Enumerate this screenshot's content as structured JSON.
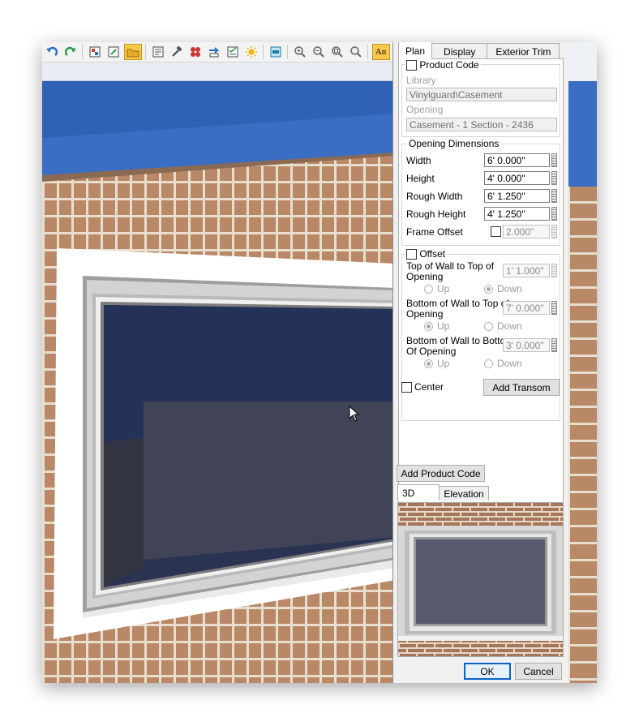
{
  "toolbar": {
    "icons": [
      "undo-icon",
      "redo-icon",
      "select-objects-icon",
      "edit-area-icon",
      "open-folder-icon",
      "plan-view-icon",
      "hammer-icon",
      "materials-icon",
      "transfer-icon",
      "checklist-icon",
      "sun-icon",
      "layer-icon",
      "zoom-in-icon",
      "zoom-out-icon",
      "zoom-fit-icon",
      "zoom-window-icon",
      "annotation-icon"
    ],
    "annotation_label": "An"
  },
  "dialog": {
    "tabs": [
      "Plan",
      "Display",
      "Exterior Trim"
    ],
    "active_tab": "Plan",
    "product_code": {
      "label": "Product Code",
      "checked": false
    },
    "library": {
      "label": "Library",
      "value": "Vinylguard\\Casement"
    },
    "opening": {
      "label": "Opening",
      "value": "Casement - 1 Section - 2436"
    },
    "opening_dimensions": {
      "title": "Opening Dimensions",
      "width": {
        "label": "Width",
        "value": "6' 0.000\""
      },
      "height": {
        "label": "Height",
        "value": "4' 0.000\""
      },
      "rough_width": {
        "label": "Rough Width",
        "value": "6' 1.250\""
      },
      "rough_height": {
        "label": "Rough Height",
        "value": "4' 1.250\""
      },
      "frame_offset": {
        "label": "Frame Offset",
        "value": "2.000\"",
        "checked": false
      }
    },
    "offset": {
      "label": "Offset",
      "checked": false,
      "top_wall_top_opening": {
        "label_line1": "Top of Wall to Top of",
        "label_line2": "Opening",
        "value": "1' 1.000\"",
        "up": "Up",
        "down": "Down",
        "selected": "Down"
      },
      "bottom_wall_top_opening": {
        "label_line1": "Bottom of Wall to Top of",
        "label_line2": "Opening",
        "value": "7' 0.000\"",
        "up": "Up",
        "down": "Down",
        "selected": "Up"
      },
      "bottom_wall_bottom_opening": {
        "label_line1": "Bottom of Wall to Bottom",
        "label_line2": "Of Opening",
        "value": "3' 0.000\"",
        "up": "Up",
        "down": "Down",
        "selected": "Up"
      }
    },
    "center": {
      "label": "Center",
      "checked": false
    },
    "add_transom_label": "Add Transom",
    "add_product_code_label": "Add Product Code",
    "preview_tabs": [
      "3D",
      "Elevation"
    ],
    "active_preview_tab": "3D",
    "ok_label": "OK",
    "cancel_label": "Cancel"
  },
  "colors": {
    "sky": "#3a6ec3",
    "brick": "#b98866",
    "mortar": "#e8decd",
    "window_frame": "#ffffff",
    "glass": "#2a3352",
    "accent": "#0a64c8"
  }
}
